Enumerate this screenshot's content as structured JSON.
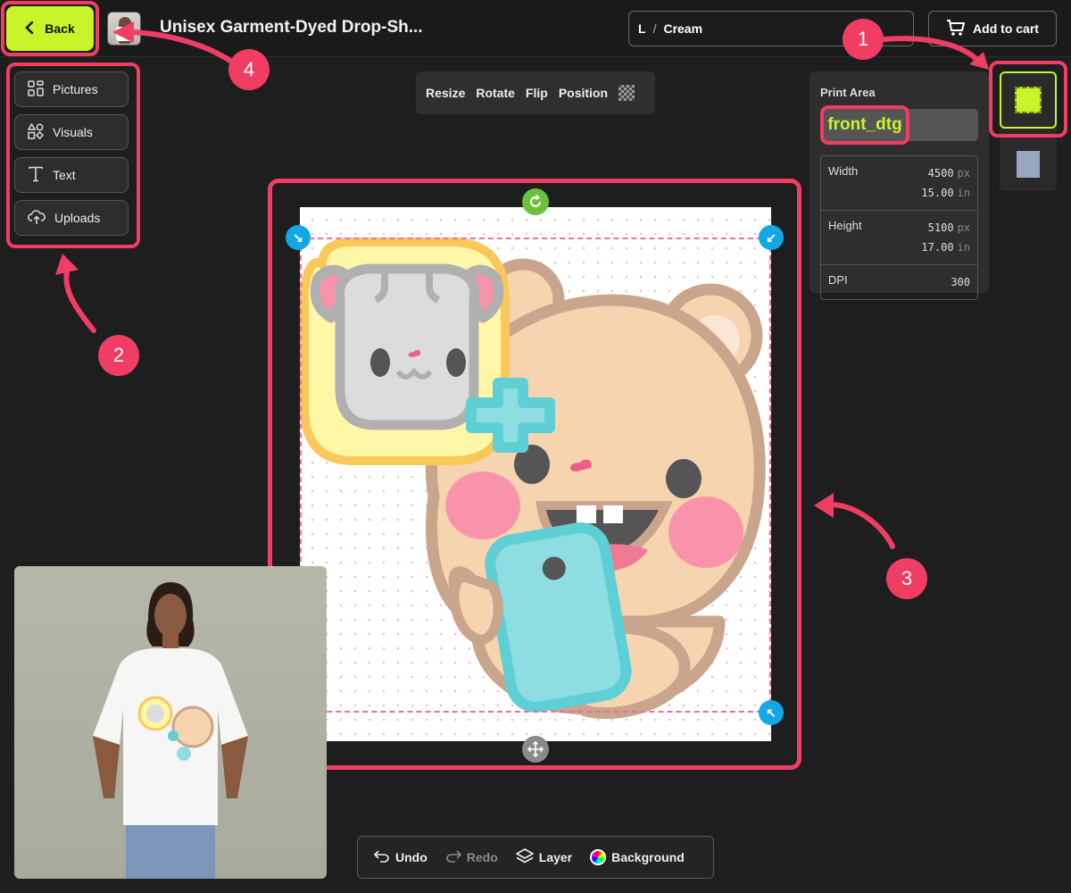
{
  "header": {
    "back_label": "Back",
    "product_title": "Unisex Garment-Dyed Drop-Sh...",
    "variant": {
      "size": "L",
      "separator": "/",
      "color": "Cream"
    },
    "cart_label": "Add to cart"
  },
  "tools": [
    {
      "label": "Pictures",
      "icon": "pictures-icon"
    },
    {
      "label": "Visuals",
      "icon": "shapes-icon"
    },
    {
      "label": "Text",
      "icon": "text-icon"
    },
    {
      "label": "Uploads",
      "icon": "upload-cloud-icon"
    }
  ],
  "transform_toolbar": {
    "resize": "Resize",
    "rotate": "Rotate",
    "flip": "Flip",
    "position": "Position"
  },
  "print_area": {
    "label": "Print Area",
    "selected": "front_dtg",
    "width": {
      "label": "Width",
      "px": "4500",
      "px_unit": "px",
      "in": "15.00",
      "in_unit": "in"
    },
    "height": {
      "label": "Height",
      "px": "5100",
      "px_unit": "px",
      "in": "17.00",
      "in_unit": "in"
    },
    "dpi": {
      "label": "DPI",
      "value": "300"
    }
  },
  "bottom_toolbar": {
    "undo": "Undo",
    "redo": "Redo",
    "layer": "Layer",
    "background": "Background"
  },
  "annotations": {
    "m1": "1",
    "m2": "2",
    "m3": "3",
    "m4": "4"
  },
  "colors": {
    "accent": "#c8f52a",
    "highlight": "#ef3d64",
    "handle": "#12a8e6"
  }
}
